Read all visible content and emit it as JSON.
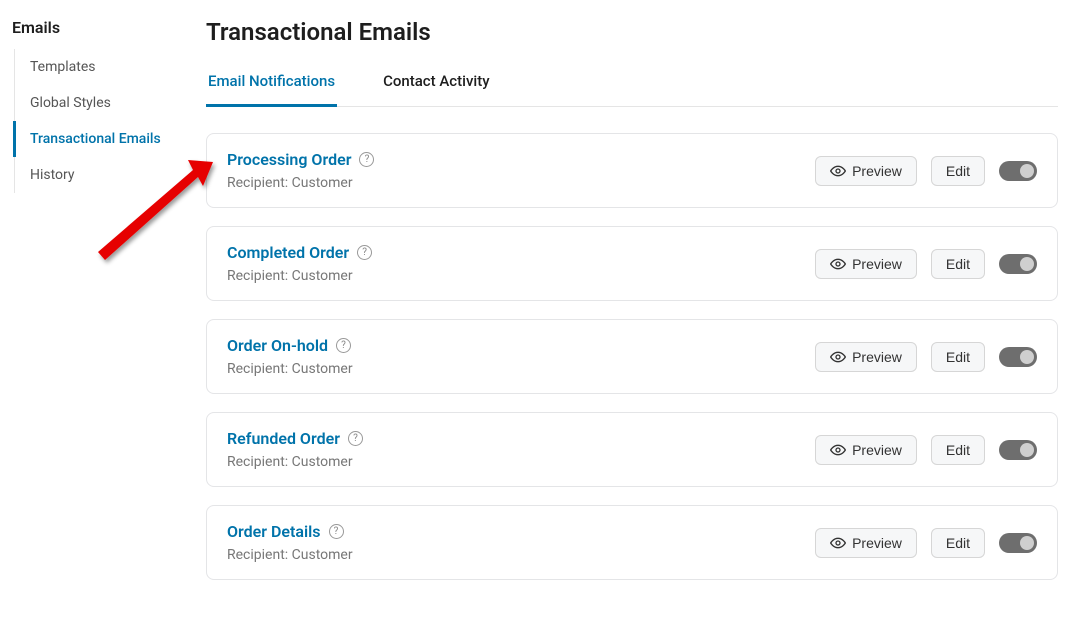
{
  "sidebar": {
    "title": "Emails",
    "items": [
      {
        "label": "Templates",
        "active": false
      },
      {
        "label": "Global Styles",
        "active": false
      },
      {
        "label": "Transactional Emails",
        "active": true
      },
      {
        "label": "History",
        "active": false
      }
    ]
  },
  "page": {
    "title": "Transactional Emails"
  },
  "tabs": {
    "items": [
      {
        "label": "Email Notifications",
        "active": true
      },
      {
        "label": "Contact Activity",
        "active": false
      }
    ]
  },
  "buttons": {
    "preview": "Preview",
    "edit": "Edit"
  },
  "labels": {
    "recipient_prefix": "Recipient: "
  },
  "cards": [
    {
      "title": "Processing Order",
      "recipient": "Customer",
      "enabled": true
    },
    {
      "title": "Completed Order",
      "recipient": "Customer",
      "enabled": true
    },
    {
      "title": "Order On-hold",
      "recipient": "Customer",
      "enabled": true
    },
    {
      "title": "Refunded Order",
      "recipient": "Customer",
      "enabled": true
    },
    {
      "title": "Order Details",
      "recipient": "Customer",
      "enabled": true
    }
  ]
}
